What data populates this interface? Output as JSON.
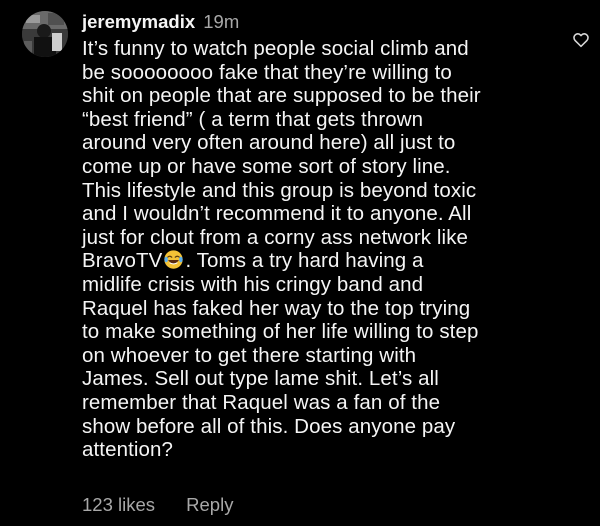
{
  "comment": {
    "username": "jeremymadix",
    "timestamp": "19m",
    "body_lines": [
      "It’s funny to watch people social climb and",
      "be soooooooo fake that they’re willing to",
      "shit on people that are supposed to be their",
      "“best friend” ( a term that gets thrown",
      "around very often around here) all just to",
      "come up or have some sort of story line.",
      "This lifestyle and this group is beyond toxic",
      "and I wouldn’t recommend it to anyone. All",
      "just for clout from a corny ass network like",
      "BravoTV",
      ". Toms  a try hard having a",
      "midlife crisis with his cringy band and",
      "Raquel has faked her way to the top trying",
      "to make something of her life willing to step",
      "on whoever to get there starting with",
      "James. Sell out type lame shit. Let’s all",
      "remember that Raquel was a fan of the",
      "show before all of this. Does anyone pay",
      "attention?"
    ],
    "emoji": "laughing-with-tears-emoji",
    "likes_label": "123 likes",
    "reply_label": "Reply",
    "like_icon": "heart-outline-icon"
  }
}
